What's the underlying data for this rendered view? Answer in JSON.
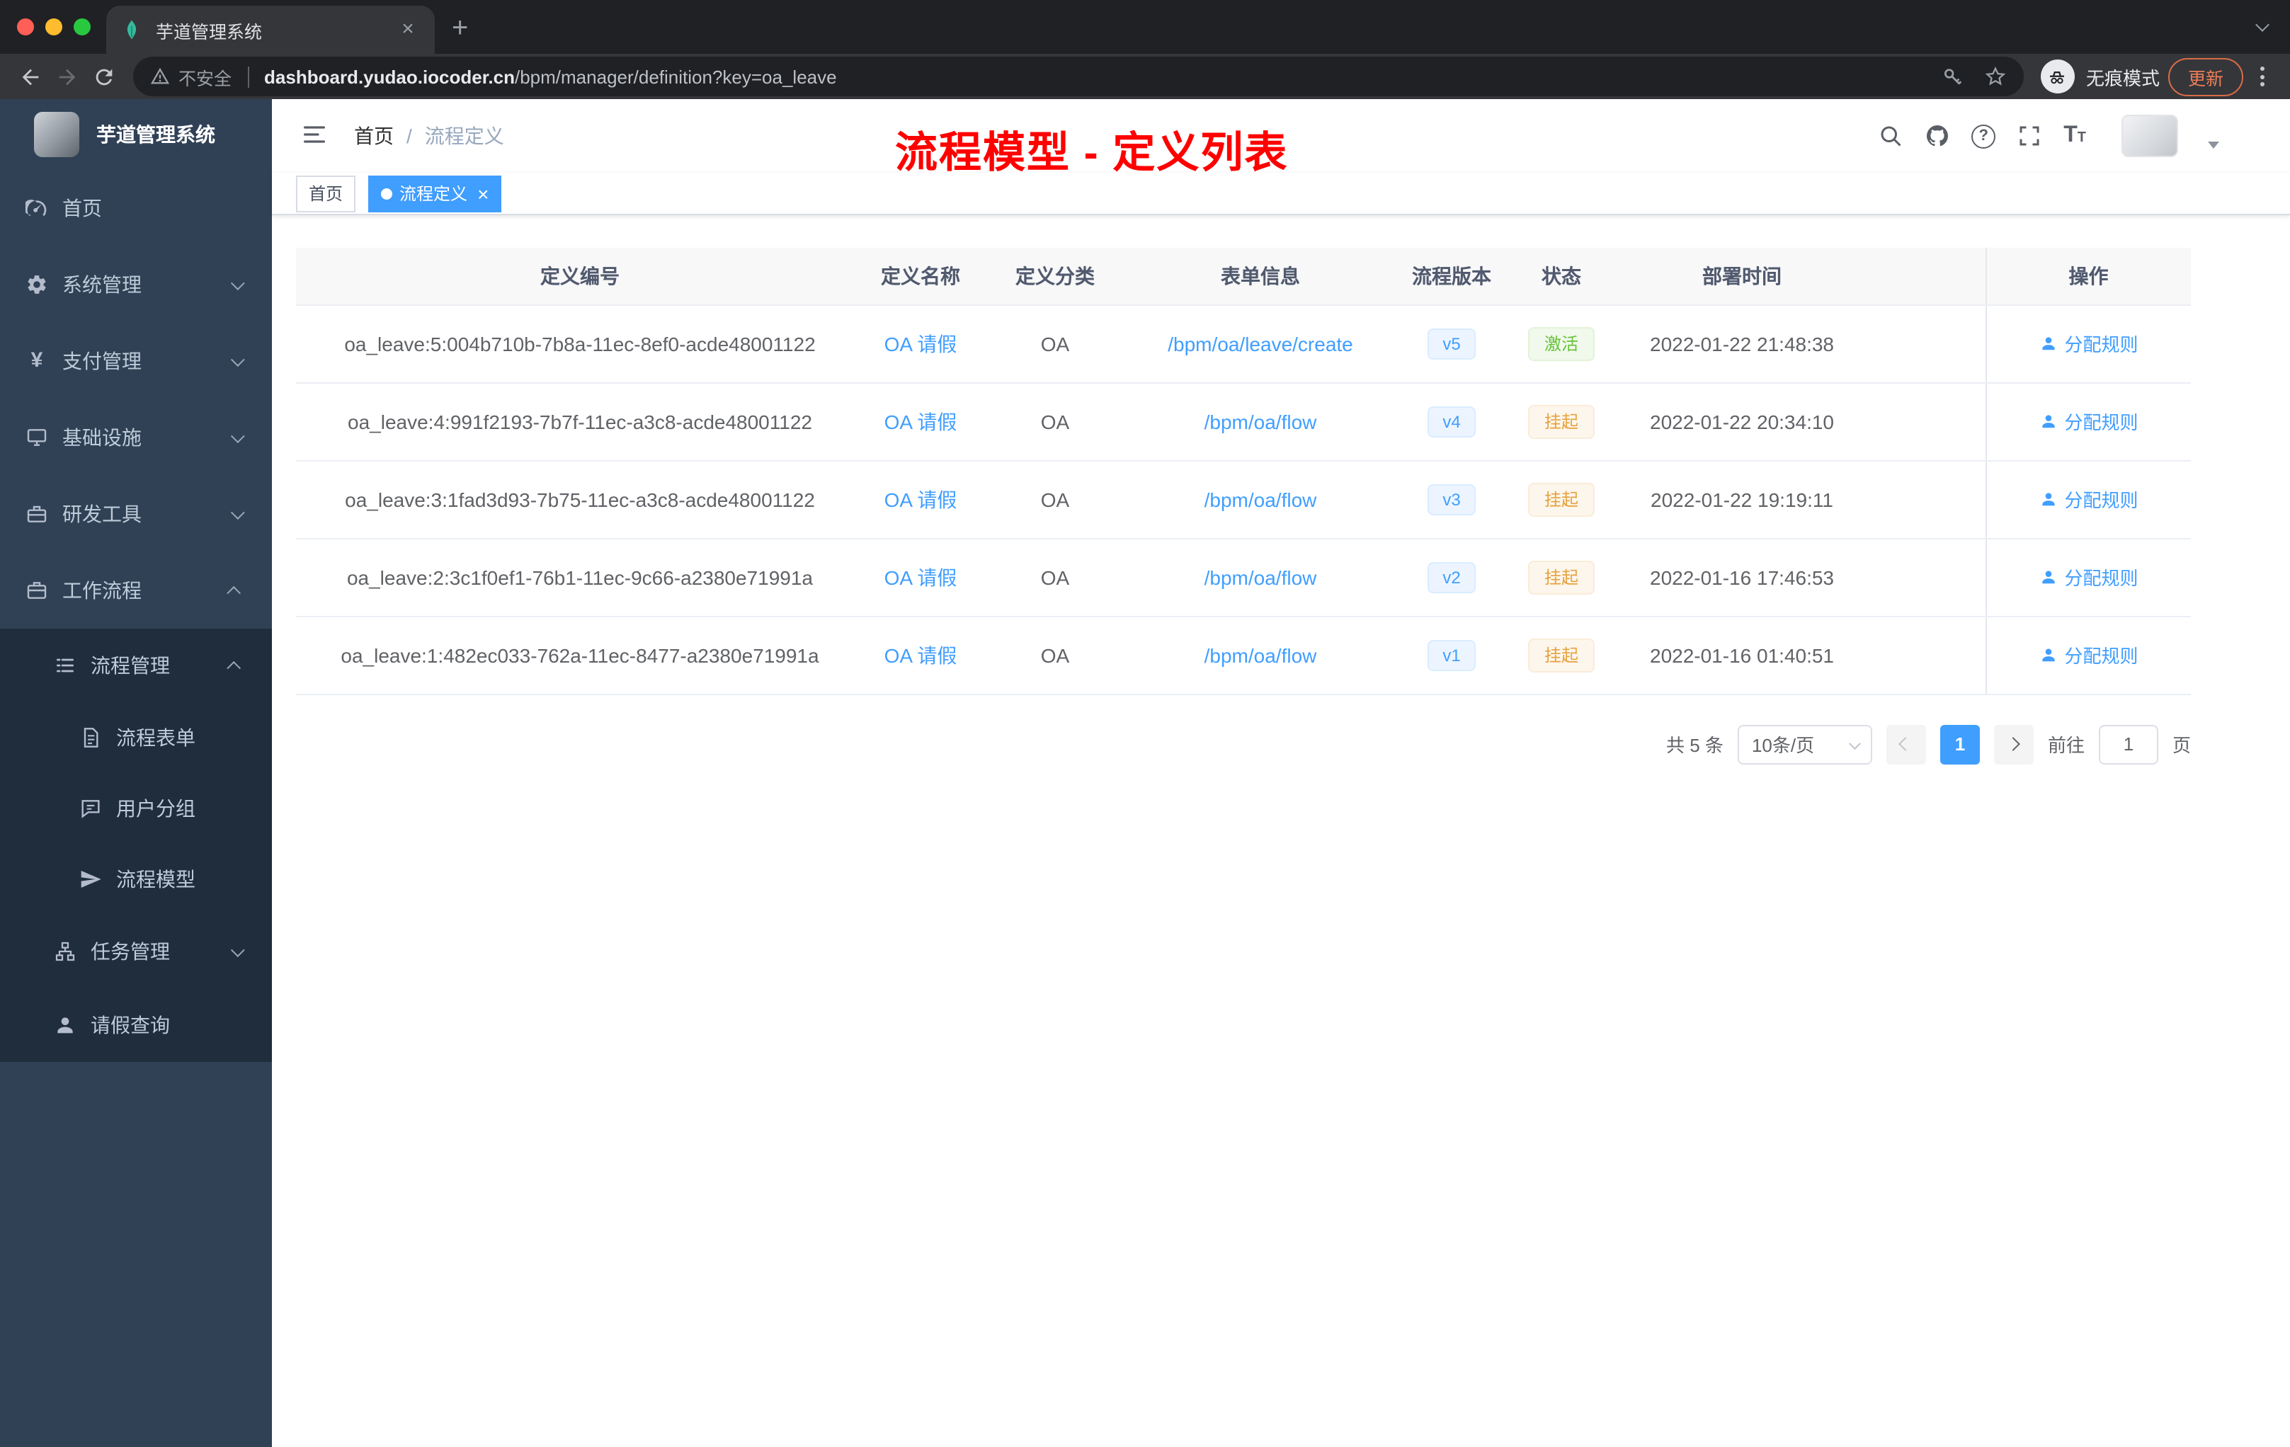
{
  "browser": {
    "tab_title": "芋道管理系统",
    "security_label": "不安全",
    "url_domain": "dashboard.yudao.iocoder.cn",
    "url_path": "/bpm/manager/definition?key=oa_leave",
    "incognito_label": "无痕模式",
    "update_label": "更新"
  },
  "sidebar": {
    "brand": "芋道管理系统",
    "top_items": [
      {
        "label": "首页"
      },
      {
        "label": "系统管理"
      },
      {
        "label": "支付管理"
      },
      {
        "label": "基础设施"
      },
      {
        "label": "研发工具"
      },
      {
        "label": "工作流程"
      }
    ],
    "process_group": {
      "label": "流程管理"
    },
    "process_children": [
      {
        "label": "流程表单"
      },
      {
        "label": "用户分组"
      },
      {
        "label": "流程模型"
      }
    ],
    "task_group": {
      "label": "任务管理"
    },
    "leave_item": {
      "label": "请假查询"
    }
  },
  "header": {
    "breadcrumb_home": "首页",
    "breadcrumb_sep": "/",
    "breadcrumb_current": "流程定义",
    "annotation": "流程模型 - 定义列表"
  },
  "tags": {
    "home": "首页",
    "active": "流程定义",
    "close": "×"
  },
  "table": {
    "columns": [
      "定义编号",
      "定义名称",
      "定义分类",
      "表单信息",
      "流程版本",
      "状态",
      "部署时间",
      "操作"
    ],
    "rows": [
      {
        "id": "oa_leave:5:004b710b-7b8a-11ec-8ef0-acde48001122",
        "name": "OA 请假",
        "category": "OA",
        "form": "/bpm/oa/leave/create",
        "version": "v5",
        "status": "激活",
        "time": "2022-01-22 21:48:38",
        "action": "分配规则"
      },
      {
        "id": "oa_leave:4:991f2193-7b7f-11ec-a3c8-acde48001122",
        "name": "OA 请假",
        "category": "OA",
        "form": "/bpm/oa/flow",
        "version": "v4",
        "status": "挂起",
        "time": "2022-01-22 20:34:10",
        "action": "分配规则"
      },
      {
        "id": "oa_leave:3:1fad3d93-7b75-11ec-a3c8-acde48001122",
        "name": "OA 请假",
        "category": "OA",
        "form": "/bpm/oa/flow",
        "version": "v3",
        "status": "挂起",
        "time": "2022-01-22 19:19:11",
        "action": "分配规则"
      },
      {
        "id": "oa_leave:2:3c1f0ef1-76b1-11ec-9c66-a2380e71991a",
        "name": "OA 请假",
        "category": "OA",
        "form": "/bpm/oa/flow",
        "version": "v2",
        "status": "挂起",
        "time": "2022-01-16 17:46:53",
        "action": "分配规则"
      },
      {
        "id": "oa_leave:1:482ec033-762a-11ec-8477-a2380e71991a",
        "name": "OA 请假",
        "category": "OA",
        "form": "/bpm/oa/flow",
        "version": "v1",
        "status": "挂起",
        "time": "2022-01-16 01:40:51",
        "action": "分配规则"
      }
    ]
  },
  "pagination": {
    "total": "共 5 条",
    "page_size": "10条/页",
    "current_page": "1",
    "goto_label": "前往",
    "goto_value": "1",
    "goto_unit": "页"
  },
  "colors": {
    "accent": "#409eff",
    "success": "#67c23a",
    "warning": "#e6a23c",
    "annotation_red": "#fe0000",
    "sidebar_bg": "#304156",
    "submenu_bg": "#1f2d3d"
  }
}
